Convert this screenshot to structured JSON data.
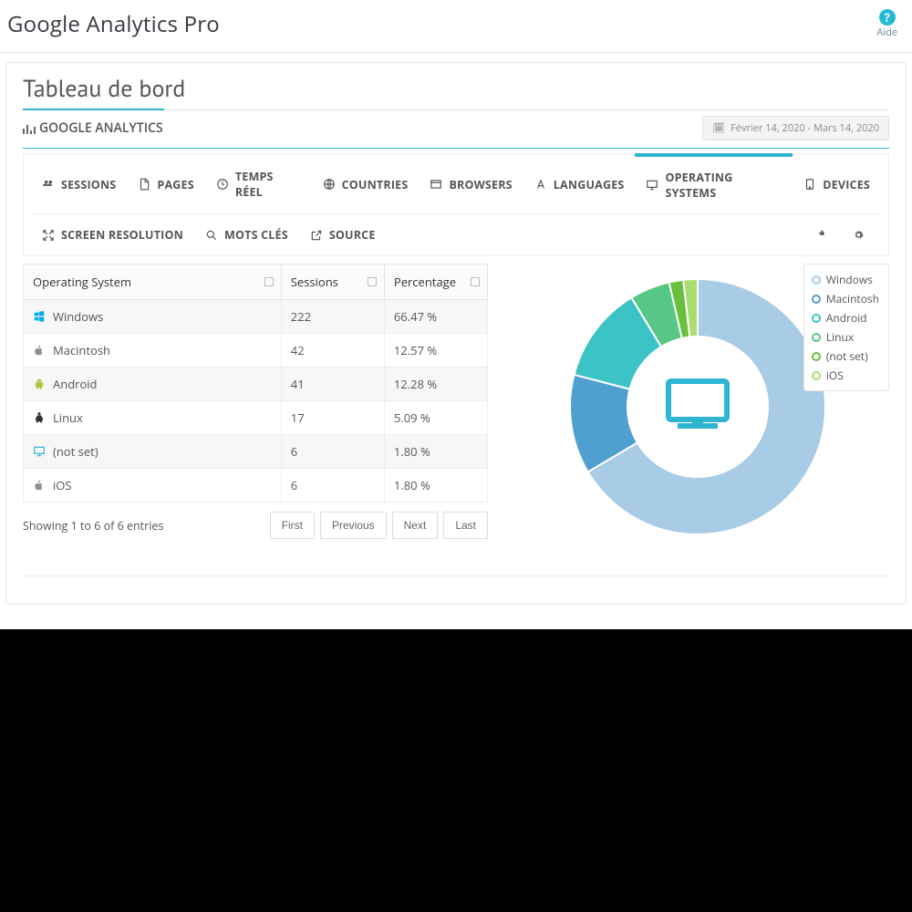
{
  "header": {
    "app_title": "Google Analytics Pro",
    "help_label": "Aide"
  },
  "panel": {
    "title": "Tableau de bord",
    "subhead": "GOOGLE ANALYTICS",
    "date_range": "Février 14, 2020 - Mars 14, 2020"
  },
  "tabs": {
    "row1": [
      {
        "label": "SESSIONS",
        "icon": "users-icon"
      },
      {
        "label": "PAGES",
        "icon": "file-icon"
      },
      {
        "label": "TEMPS RÉEL",
        "icon": "clock-icon"
      },
      {
        "label": "COUNTRIES",
        "icon": "globe-icon"
      },
      {
        "label": "BROWSERS",
        "icon": "window-icon"
      },
      {
        "label": "LANGUAGES",
        "icon": "font-icon"
      },
      {
        "label": "OPERATING SYSTEMS",
        "icon": "desktop-icon",
        "active": true
      },
      {
        "label": "DEVICES",
        "icon": "tablet-icon"
      }
    ],
    "row2": [
      {
        "label": "SCREEN RESOLUTION",
        "icon": "expand-icon"
      },
      {
        "label": "MOTS CLÉS",
        "icon": "search-icon"
      },
      {
        "label": "SOURCE",
        "icon": "external-icon"
      }
    ]
  },
  "table": {
    "columns": [
      "Operating System",
      "Sessions",
      "Percentage"
    ],
    "rows": [
      {
        "os": "Windows",
        "icon": "windows",
        "color": "#00adef",
        "sessions": "222",
        "pct": "66.47 %"
      },
      {
        "os": "Macintosh",
        "icon": "apple",
        "color": "#8e8e8e",
        "sessions": "42",
        "pct": "12.57 %"
      },
      {
        "os": "Android",
        "icon": "android",
        "color": "#a4c639",
        "sessions": "41",
        "pct": "12.28 %"
      },
      {
        "os": "Linux",
        "icon": "linux",
        "color": "#333",
        "sessions": "17",
        "pct": "5.09 %"
      },
      {
        "os": "(not set)",
        "icon": "monitor",
        "color": "#2fb5d2",
        "sessions": "6",
        "pct": "1.80 %"
      },
      {
        "os": "iOS",
        "icon": "apple",
        "color": "#8e8e8e",
        "sessions": "6",
        "pct": "1.80 %"
      }
    ],
    "info": "Showing 1 to 6 of 6 entries",
    "pager": [
      "First",
      "Previous",
      "Next",
      "Last"
    ]
  },
  "chart_data": {
    "type": "pie",
    "title": "",
    "series": [
      {
        "name": "Sessions",
        "values": [
          222,
          42,
          41,
          17,
          6,
          6
        ]
      }
    ],
    "categories": [
      "Windows",
      "Macintosh",
      "Android",
      "Linux",
      "(not set)",
      "iOS"
    ],
    "colors": [
      "#a8cbe6",
      "#4f9fd0",
      "#3cc3c6",
      "#57c785",
      "#69bf3e",
      "#aadc6f"
    ],
    "donut_inner_ratio": 0.55
  }
}
